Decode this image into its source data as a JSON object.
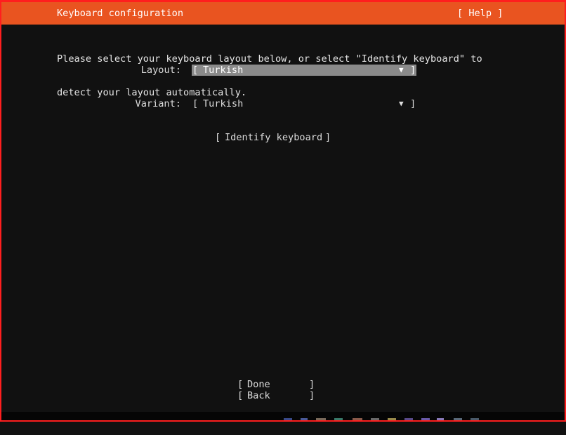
{
  "header": {
    "title": "Keyboard configuration",
    "help_label": "[ Help ]"
  },
  "intro": {
    "line1": "Please select your keyboard layout below, or select \"Identify keyboard\" to",
    "line2": "detect your layout automatically."
  },
  "layout": {
    "label": "Layout:",
    "value": "Turkish",
    "focused": true
  },
  "variant": {
    "label": "Variant:",
    "value": "Turkish"
  },
  "identify": {
    "label": "Identify keyboard"
  },
  "actions": {
    "done_label": "Done",
    "back_label": "Back"
  },
  "glyphs": {
    "bracket_open": "[",
    "bracket_close": "]",
    "dropdown_arrow": "▼"
  },
  "colors": {
    "accent": "#e95420",
    "background": "#111111",
    "focus": "#8a8a8a",
    "frame_border": "#ff1e1e"
  }
}
